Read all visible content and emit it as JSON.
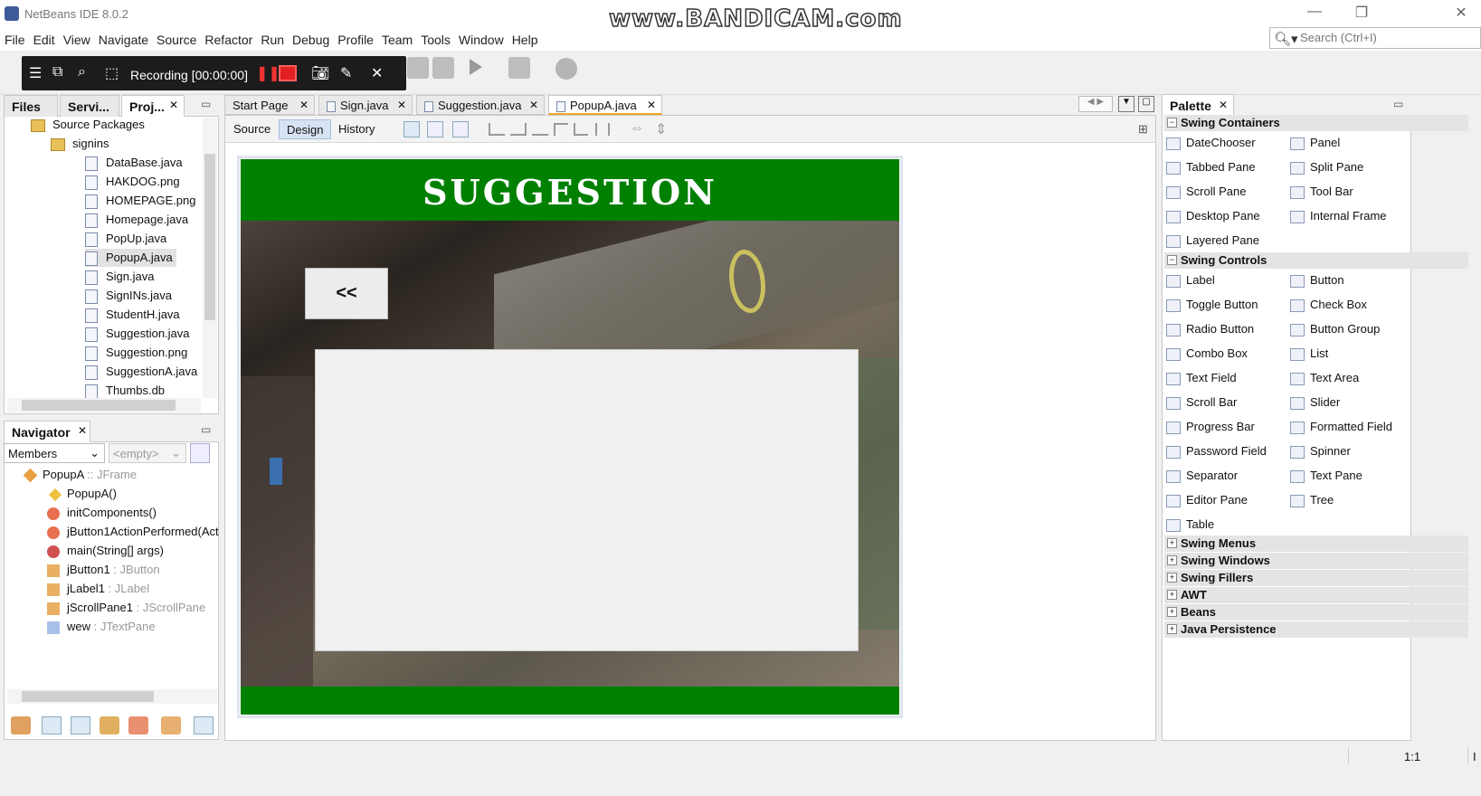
{
  "window": {
    "title": "NetBeans IDE 8.0.2",
    "watermark": "www.BANDICAM.com"
  },
  "menu": [
    "File",
    "Edit",
    "View",
    "Navigate",
    "Source",
    "Refactor",
    "Run",
    "Debug",
    "Profile",
    "Team",
    "Tools",
    "Window",
    "Help"
  ],
  "search": {
    "placeholder": "Search (Ctrl+I)"
  },
  "recording": {
    "label": "Recording [00:00:00]"
  },
  "left_tabs": {
    "files": "Files",
    "services": "Servi...",
    "projects": "Proj..."
  },
  "project_tree": {
    "source_packages": "Source Packages",
    "package": "signins",
    "files": [
      "DataBase.java",
      "HAKDOG.png",
      "HOMEPAGE.png",
      "Homepage.java",
      "PopUp.java",
      "PopupA.java",
      "Sign.java",
      "SignINs.java",
      "StudentH.java",
      "Suggestion.java",
      "Suggestion.png",
      "SuggestionA.java",
      "Thumbs.db"
    ],
    "selected": "PopupA.java"
  },
  "navigator": {
    "title": "Navigator",
    "filter": "Members",
    "filter2": "<empty>",
    "root": {
      "name": "PopupA",
      "type": " :: JFrame"
    },
    "members": [
      {
        "name": "PopupA()",
        "type": ""
      },
      {
        "name": "initComponents()",
        "type": ""
      },
      {
        "name": "jButton1ActionPerformed(Act",
        "type": ""
      },
      {
        "name": "main(String[] args)",
        "type": ""
      },
      {
        "name": "jButton1",
        "type": " : JButton"
      },
      {
        "name": "jLabel1",
        "type": " : JLabel"
      },
      {
        "name": "jScrollPane1",
        "type": " : JScrollPane"
      },
      {
        "name": "wew",
        "type": " : JTextPane"
      }
    ]
  },
  "editor": {
    "tabs": [
      "Start Page",
      "Sign.java",
      "Suggestion.java",
      "PopupA.java"
    ],
    "active_tab": "PopupA.java",
    "views": [
      "Source",
      "Design",
      "History"
    ],
    "active_view": "Design"
  },
  "form": {
    "title": "SUGGESTION",
    "back_button": "<<",
    "colors": {
      "banner": "#008000"
    }
  },
  "palette": {
    "title": "Palette",
    "swing_containers": {
      "label": "Swing Containers",
      "items": [
        "DateChooser",
        "Panel",
        "Tabbed Pane",
        "Split Pane",
        "Scroll Pane",
        "Tool Bar",
        "Desktop Pane",
        "Internal Frame",
        "Layered Pane"
      ]
    },
    "swing_controls": {
      "label": "Swing Controls",
      "items": [
        "Label",
        "Button",
        "Toggle Button",
        "Check Box",
        "Radio Button",
        "Button Group",
        "Combo Box",
        "List",
        "Text Field",
        "Text Area",
        "Scroll Bar",
        "Slider",
        "Progress Bar",
        "Formatted Field",
        "Password Field",
        "Spinner",
        "Separator",
        "Text Pane",
        "Editor Pane",
        "Tree",
        "Table"
      ]
    },
    "collapsed": [
      "Swing Menus",
      "Swing Windows",
      "Swing Fillers",
      "AWT",
      "Beans",
      "Java Persistence"
    ]
  },
  "status": {
    "position": "1:1",
    "mode": "I"
  }
}
